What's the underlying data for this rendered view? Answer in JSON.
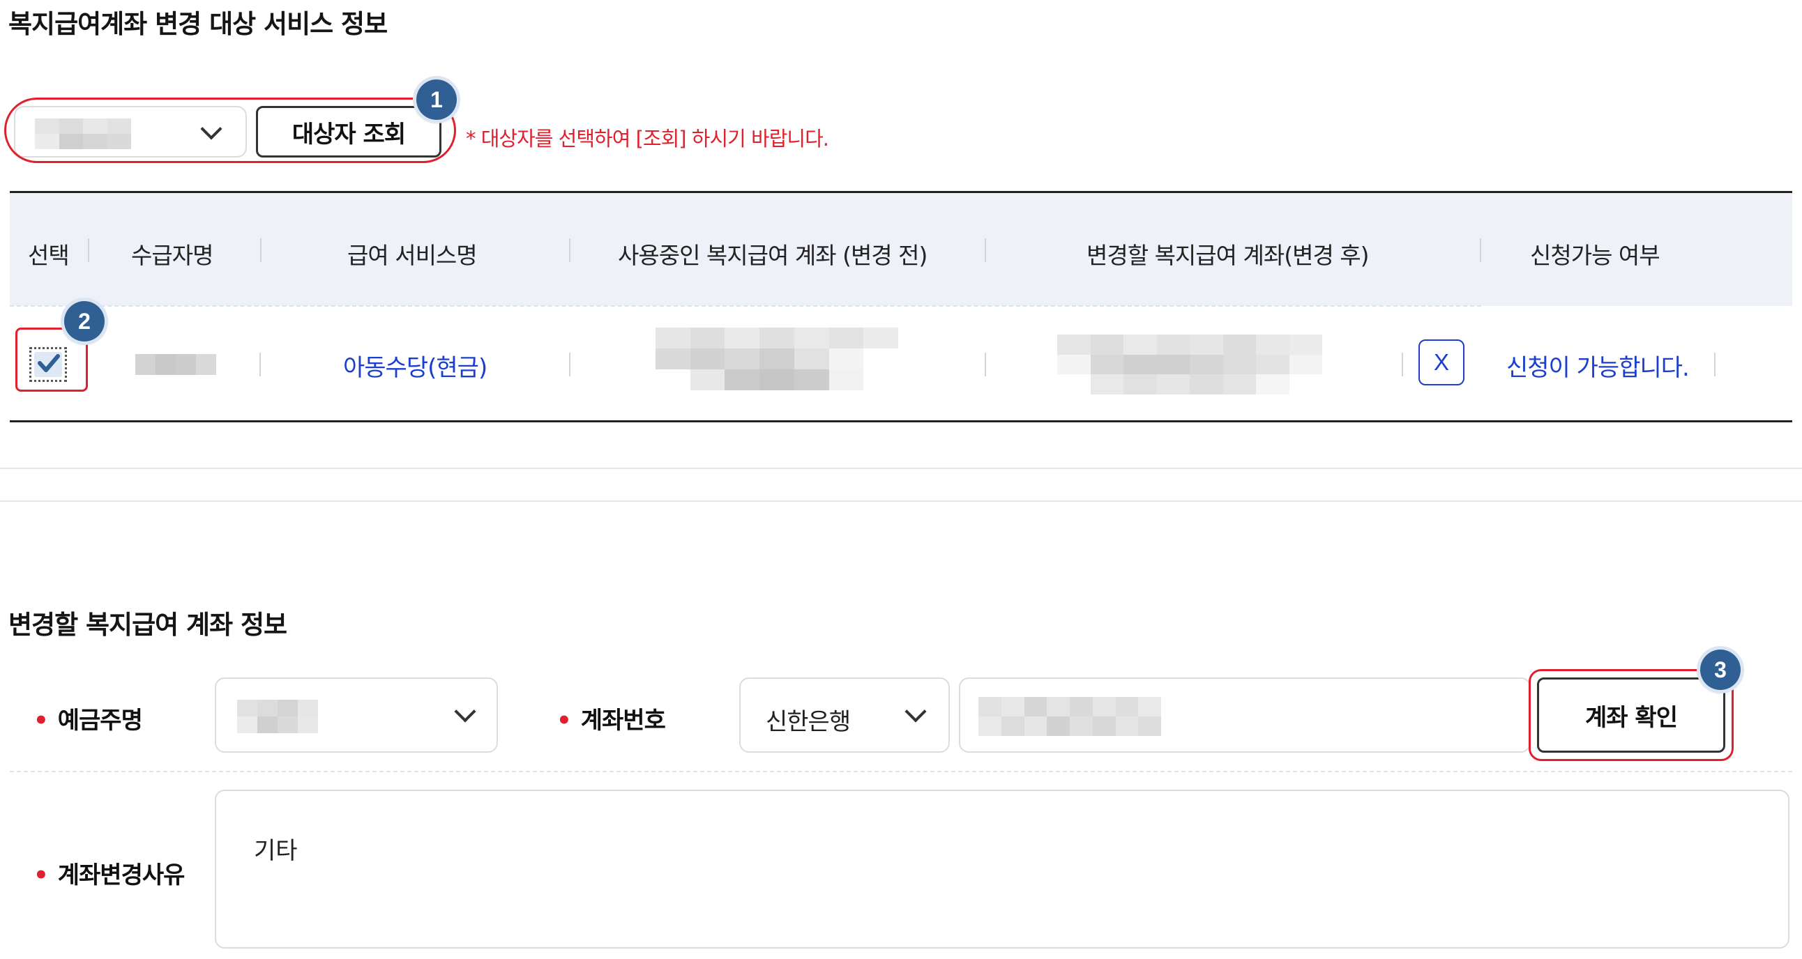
{
  "section1": {
    "title": "복지급여계좌 변경 대상 서비스 정보",
    "search_button": "대상자 조회",
    "hint": "* 대상자를 선택하여 [조회] 하시기 바랍니다.",
    "badge1": "1",
    "badge2": "2"
  },
  "table": {
    "headers": [
      "선택",
      "수급자명",
      "급여 서비스명",
      "사용중인 복지급여 계좌 (변경 전)",
      "변경할 복지급여 계좌(변경 후)",
      "신청가능 여부"
    ],
    "row": {
      "service": "아동수당(현금)",
      "delete_label": "X",
      "status": "신청이 가능합니다."
    }
  },
  "section2": {
    "title": "변경할 복지급여 계좌 정보",
    "holder_label": "예금주명",
    "account_label": "계좌번호",
    "bank": "신한은행",
    "confirm_button": "계좌 확인",
    "reason_label": "계좌변경사유",
    "reason_value": "기타",
    "badge3": "3",
    "required_mark": "•"
  },
  "colors": {
    "accent_red": "#e0212d",
    "link_blue": "#1a3fcf",
    "badge_blue": "#2f5f93",
    "header_bg": "#eef1f8"
  }
}
